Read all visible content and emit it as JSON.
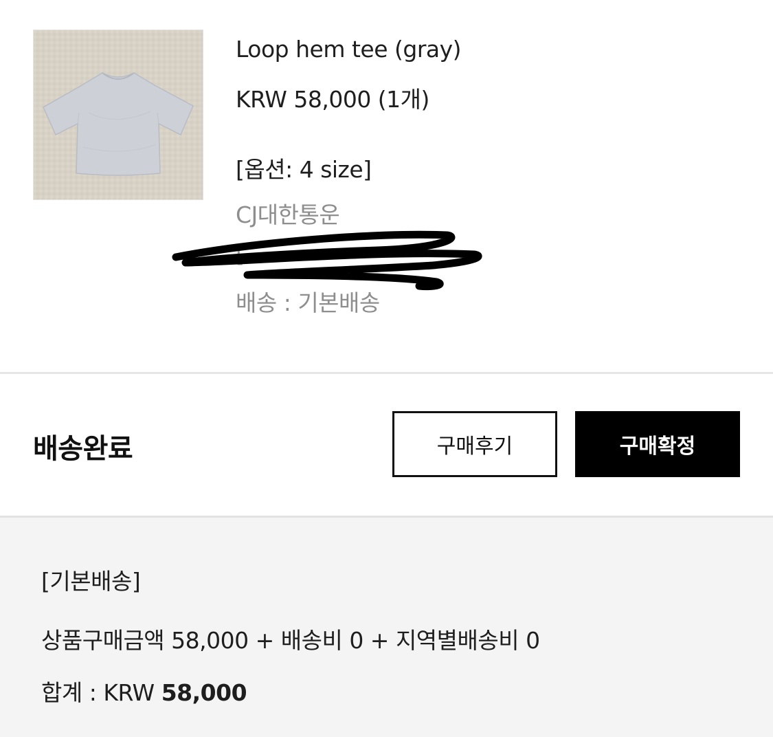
{
  "product": {
    "image_alt": "gray loop hem t-shirt photo",
    "name": "Loop hem tee (gray)",
    "price": "KRW 58,000 (1개)",
    "option": "[옵션: 4 size]",
    "carrier": "CJ대한통운",
    "tracking": "[",
    "shipping_method": "배송 : 기본배송"
  },
  "order_status": {
    "label": "배송완료",
    "review_button": "구매후기",
    "confirm_button": "구매확정"
  },
  "summary": {
    "method": "[기본배송]",
    "formula": "상품구매금액 58,000 + 배송비 0 + 지역별배송비 0",
    "total_prefix": "합계 : KRW",
    "total_amount": "58,000"
  }
}
